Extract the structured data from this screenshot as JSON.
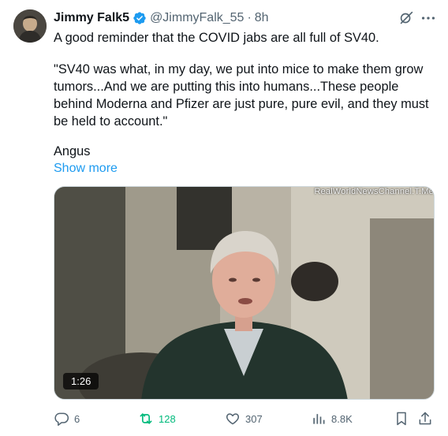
{
  "author": {
    "name": "Jimmy Falk5",
    "handle": "@JimmyFalk_55",
    "separator": "·",
    "time": "8h",
    "verified_color": "#1d9bf0"
  },
  "tweet": {
    "line1": "A good reminder that the COVID  jabs are all full of SV40.",
    "quote": "\"SV40 was what, in my day, we put into mice to make them grow tumors...And we are putting this into humans...These people behind Moderna and Pfizer are just pure, pure evil, and they must be held to account.\"",
    "signature": "Angus",
    "show_more": "Show more"
  },
  "media": {
    "watermark": "RealWorldNewsChannel.T.Me",
    "duration": "1:26"
  },
  "actions": {
    "replies": "6",
    "retweets": "128",
    "likes": "307",
    "views": "8.8K"
  },
  "icons": {
    "header": [
      "grok-icon",
      "more-icon"
    ],
    "actions": [
      "reply-icon",
      "retweet-icon",
      "like-icon",
      "views-icon",
      "bookmark-icon",
      "share-icon"
    ]
  },
  "colors": {
    "link": "#1d9bf0",
    "retweet": "#00ba7c",
    "muted": "#536471",
    "text": "#0f1419"
  }
}
